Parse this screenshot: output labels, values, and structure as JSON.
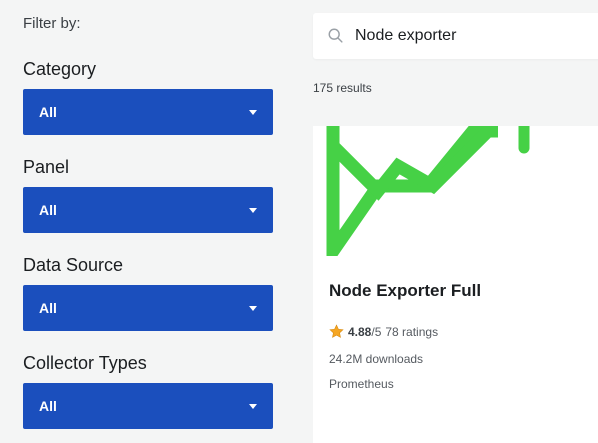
{
  "filters": {
    "heading": "Filter by:",
    "groups": [
      {
        "label": "Category",
        "value": "All"
      },
      {
        "label": "Panel",
        "value": "All"
      },
      {
        "label": "Data Source",
        "value": "All"
      },
      {
        "label": "Collector Types",
        "value": "All"
      }
    ]
  },
  "search": {
    "value": "Node exporter",
    "icon": "search-icon"
  },
  "results": {
    "count_text": "175 results"
  },
  "card": {
    "title": "Node Exporter Full",
    "rating_value": "4.88",
    "rating_scale": "/5",
    "rating_count": "78 ratings",
    "downloads": "24.2M downloads",
    "datasource": "Prometheus",
    "graphic_color": "#46d146",
    "star_color": "#f5a623"
  },
  "colors": {
    "select_bg": "#1b4fbd",
    "page_bg": "#f4f5f5"
  }
}
